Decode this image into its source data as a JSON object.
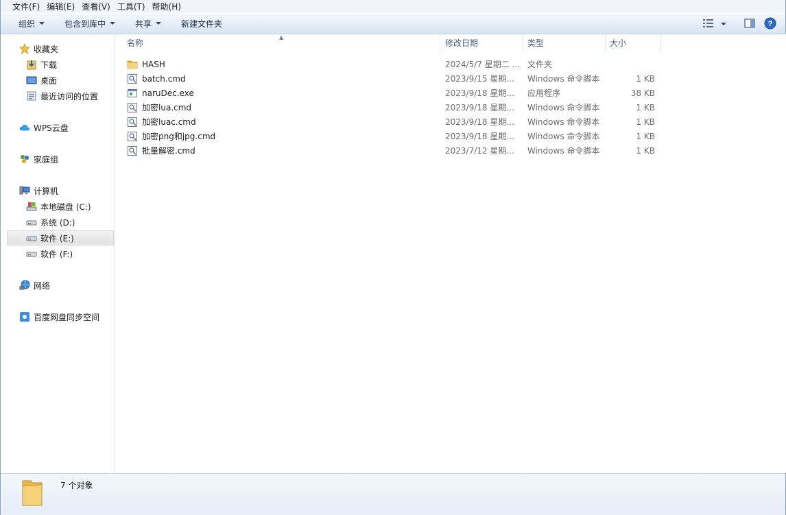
{
  "menu": [
    "文件(F)",
    "编辑(E)",
    "查看(V)",
    "工具(T)",
    "帮助(H)"
  ],
  "toolbar": {
    "organize": "组织",
    "include_library": "包含到库中",
    "share": "共享",
    "new_folder": "新建文件夹"
  },
  "nav": {
    "favorites": "收藏夹",
    "downloads": "下载",
    "desktop": "桌面",
    "recent": "最近访问的位置",
    "wps": "WPS云盘",
    "homegroup": "家庭组",
    "computer": "计算机",
    "drive_c": "本地磁盘 (C:)",
    "drive_d": "系统 (D:)",
    "drive_e": "软件 (E:)",
    "drive_f": "软件 (F:)",
    "network": "网络",
    "baidu": "百度网盘同步空间"
  },
  "columns": {
    "name": "名称",
    "date": "修改日期",
    "type": "类型",
    "size": "大小"
  },
  "files": [
    {
      "name": "HASH",
      "date": "2024/5/7 星期二 ...",
      "type": "文件夹",
      "size": "",
      "icon": "folder-icon"
    },
    {
      "name": "batch.cmd",
      "date": "2023/9/15 星期...",
      "type": "Windows 命令脚本",
      "size": "1 KB",
      "icon": "cmd-script-icon"
    },
    {
      "name": "naruDec.exe",
      "date": "2023/9/18 星期...",
      "type": "应用程序",
      "size": "38 KB",
      "icon": "exe-icon"
    },
    {
      "name": "加密lua.cmd",
      "date": "2023/9/18 星期...",
      "type": "Windows 命令脚本",
      "size": "1 KB",
      "icon": "cmd-script-icon"
    },
    {
      "name": "加密luac.cmd",
      "date": "2023/9/18 星期...",
      "type": "Windows 命令脚本",
      "size": "1 KB",
      "icon": "cmd-script-icon"
    },
    {
      "name": "加密png和jpg.cmd",
      "date": "2023/9/18 星期...",
      "type": "Windows 命令脚本",
      "size": "1 KB",
      "icon": "cmd-script-icon"
    },
    {
      "name": "批量解密.cmd",
      "date": "2023/7/12 星期...",
      "type": "Windows 命令脚本",
      "size": "1 KB",
      "icon": "cmd-script-icon"
    }
  ],
  "details": {
    "count": "7 个对象"
  },
  "colors": {
    "toolbar_bg": "#dbe6f3",
    "selection": "#e4e4e4",
    "folder": "#f2c660"
  }
}
